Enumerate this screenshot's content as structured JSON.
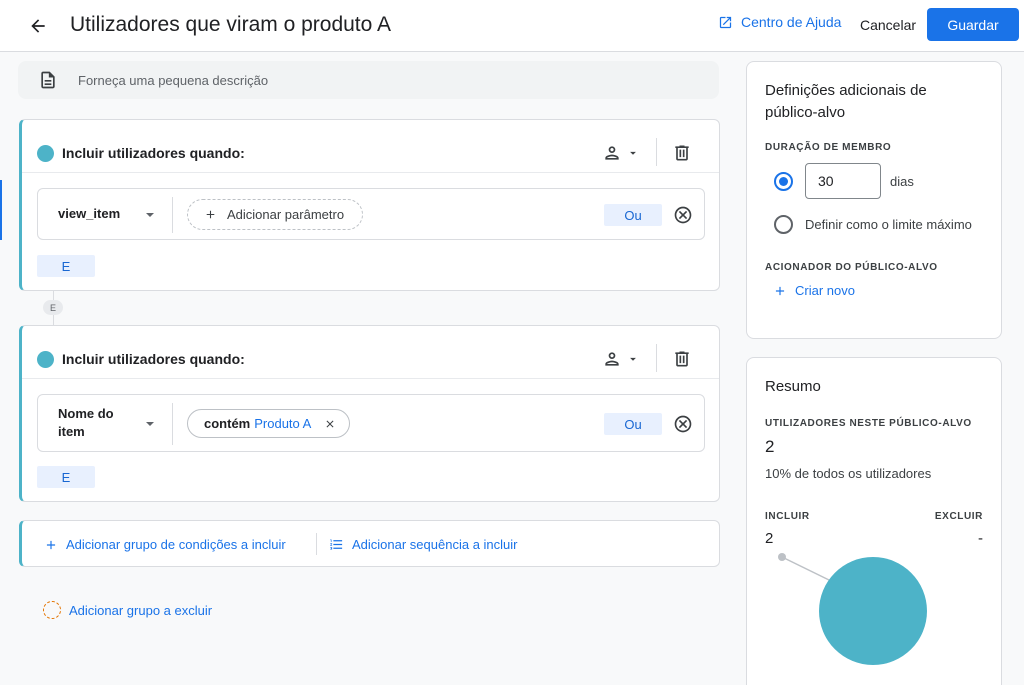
{
  "header": {
    "title": "Utilizadores que viram o produto A",
    "help_label": "Centro de Ajuda",
    "cancel_label": "Cancelar",
    "save_label": "Guardar"
  },
  "description": {
    "placeholder": "Forneça uma pequena descrição"
  },
  "groups": [
    {
      "title": "Incluir utilizadores quando:",
      "condition": {
        "event": "view_item",
        "add_param_label": "Adicionar parâmetro",
        "or_label": "Ou"
      },
      "and_label": "E"
    },
    {
      "title": "Incluir utilizadores quando:",
      "condition": {
        "event_line1": "Nome do",
        "event_line2": "item",
        "chip_operator": "contém",
        "chip_value": "Produto A",
        "or_label": "Ou"
      },
      "and_label": "E"
    }
  ],
  "connector_label": "E",
  "actions": {
    "add_condition_group": "Adicionar grupo de condições a incluir",
    "add_sequence": "Adicionar sequência a incluir",
    "add_exclude_group": "Adicionar grupo a excluir"
  },
  "settings": {
    "title_line1": "Definições adicionais de",
    "title_line2": "público-alvo",
    "duration_label": "DURAÇÃO DE MEMBRO",
    "duration_value": "30",
    "duration_unit": "dias",
    "max_limit_label": "Definir como o limite máximo",
    "trigger_label": "ACIONADOR DO PÚBLICO-ALVO",
    "create_new_label": "Criar novo"
  },
  "summary": {
    "title": "Resumo",
    "users_label": "UTILIZADORES NESTE PÚBLICO-ALVO",
    "users_count": "2",
    "users_percent": "10% de todos os utilizadores",
    "include_label": "INCLUIR",
    "exclude_label": "EXCLUIR",
    "include_count": "2",
    "exclude_count": "-"
  },
  "colors": {
    "accent": "#1a73e8",
    "group_dot": "#4db3c8",
    "pie": "#4db3c8"
  }
}
